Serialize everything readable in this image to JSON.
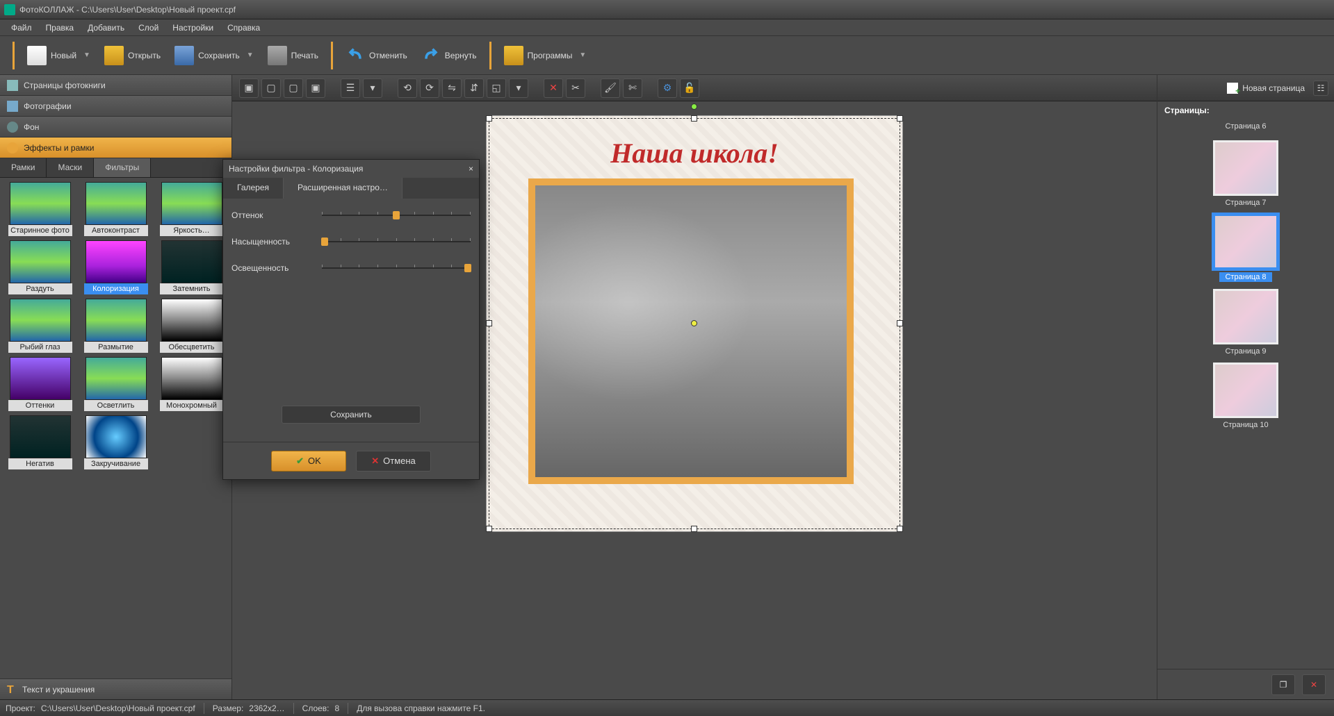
{
  "titlebar": {
    "app_name": "ФотоКОЛЛАЖ",
    "project_path": "C:\\Users\\User\\Desktop\\Новый проект.cpf"
  },
  "menu": {
    "file": "Файл",
    "edit": "Правка",
    "add": "Добавить",
    "layer": "Слой",
    "settings": "Настройки",
    "help": "Справка"
  },
  "toolbar": {
    "new": "Новый",
    "open": "Открыть",
    "save": "Сохранить",
    "print": "Печать",
    "undo": "Отменить",
    "redo": "Вернуть",
    "apps": "Программы"
  },
  "left": {
    "pages": "Страницы фотокниги",
    "photos": "Фотографии",
    "background": "Фон",
    "effects": "Эффекты и рамки",
    "tabs": {
      "frames": "Рамки",
      "masks": "Маски",
      "filters": "Фильтры"
    },
    "filters": [
      "Старинное фото",
      "Автоконтраст",
      "Яркость…",
      "Раздуть",
      "Колоризация",
      "Затемнить",
      "Рыбий глаз",
      "Размытие",
      "Обесцветить",
      "Оттенки",
      "Осветлить",
      "Монохромный",
      "Негатив",
      "Закручивание"
    ],
    "selected_filter_index": 4,
    "text_deco": "Текст и украшения"
  },
  "canvas": {
    "heading_text": "Наша школа!"
  },
  "right": {
    "new_page": "Новая страница",
    "title": "Страницы:",
    "pages": [
      "Страница 6",
      "Страница 7",
      "Страница 8",
      "Страница 9",
      "Страница 10"
    ],
    "selected_index": 2
  },
  "dialog": {
    "title": "Настройки фильтра - Колоризация",
    "tab_gallery": "Галерея",
    "tab_advanced": "Расширенная настро…",
    "sliders": {
      "hue": {
        "label": "Оттенок",
        "value": 50
      },
      "sat": {
        "label": "Насыщенность",
        "value": 2
      },
      "lit": {
        "label": "Освещенность",
        "value": 98
      }
    },
    "save": "Сохранить",
    "ok": "OK",
    "cancel": "Отмена"
  },
  "statusbar": {
    "project_label": "Проект:",
    "project_path": "C:\\Users\\User\\Desktop\\Новый проект.cpf",
    "size_label": "Размер:",
    "size_value": "2362x2…",
    "layers_label": "Слоев:",
    "layers_value": "8",
    "help_hint": "Для вызова справки нажмите F1."
  }
}
